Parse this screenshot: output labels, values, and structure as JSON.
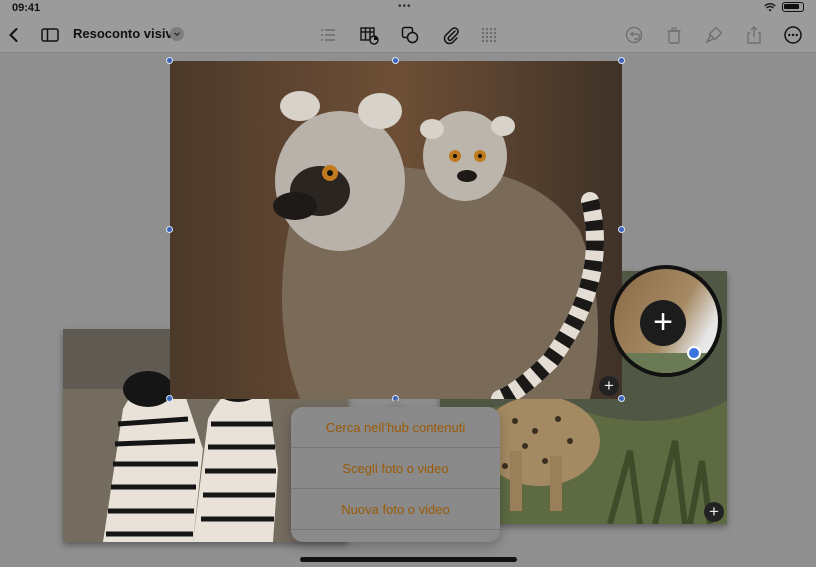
{
  "status": {
    "time": "09:41",
    "dots": "•••"
  },
  "toolbar": {
    "title": "Resoconto visivo",
    "icons": [
      "back-icon",
      "sidebar-icon",
      "title-menu-chevron-icon",
      "list-icon",
      "table-chart-icon",
      "shapes-icon",
      "attachment-icon",
      "grid-icon",
      "undo-icon",
      "delete-icon",
      "format-brush-icon",
      "share-icon",
      "more-icon"
    ]
  },
  "popover": {
    "items": [
      {
        "label": "Cerca nell’hub contenuti"
      },
      {
        "label": "Scegli foto o video"
      },
      {
        "label": "Nuova foto o video"
      }
    ]
  },
  "canvas": {
    "add_symbol": "+",
    "photos": [
      "lemur-photo",
      "zebra-photo",
      "cheetah-photo"
    ]
  },
  "colors": {
    "accent": "#9a5a06",
    "selection": "#3b64b8",
    "background": "#8f8f8f"
  }
}
